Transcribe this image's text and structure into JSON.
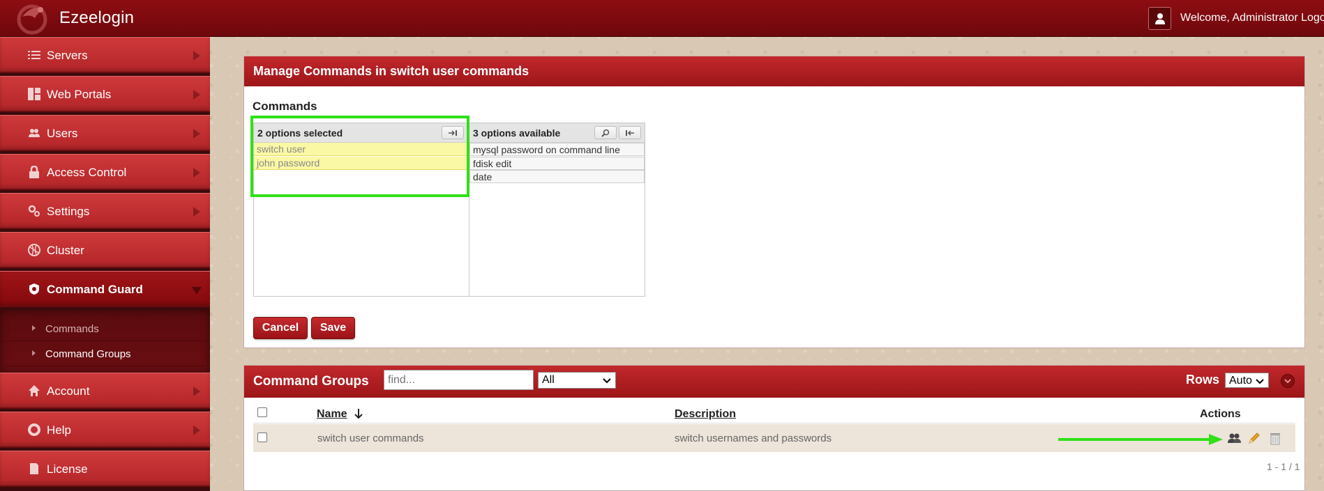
{
  "app": {
    "title": "Ezeelogin",
    "welcome": "Welcome, Administrator Logout"
  },
  "sidebar": {
    "items": [
      {
        "label": "Servers",
        "icon": "list-icon"
      },
      {
        "label": "Web Portals",
        "icon": "dashboard-icon"
      },
      {
        "label": "Users",
        "icon": "users-icon"
      },
      {
        "label": "Access Control",
        "icon": "lock-icon"
      },
      {
        "label": "Settings",
        "icon": "gears-icon"
      },
      {
        "label": "Cluster",
        "icon": "globe-icon"
      },
      {
        "label": "Command Guard",
        "icon": "shield-icon"
      },
      {
        "label": "Account",
        "icon": "home-icon"
      },
      {
        "label": "Help",
        "icon": "lifebuoy-icon"
      },
      {
        "label": "License",
        "icon": "document-icon"
      }
    ],
    "subitems": [
      {
        "label": "Commands"
      },
      {
        "label": "Command Groups"
      }
    ]
  },
  "manage_panel": {
    "title": "Manage Commands in switch user commands",
    "commands_label": "Commands",
    "selected": {
      "header": "2 options selected",
      "options": [
        "switch user",
        "john password"
      ]
    },
    "available": {
      "header": "3 options available",
      "options": [
        "mysql password on command line",
        "fdisk edit",
        "date"
      ]
    },
    "cancel_label": "Cancel",
    "save_label": "Save"
  },
  "groups_panel": {
    "title": "Command Groups",
    "search_placeholder": "find...",
    "filter_value": "All",
    "rows_label": "Rows",
    "rows_value": "Auto",
    "columns": {
      "name": "Name",
      "description": "Description",
      "actions": "Actions"
    },
    "rows": [
      {
        "name": "switch user commands",
        "description": "switch usernames and passwords"
      }
    ],
    "pager": "1 - 1 / 1"
  },
  "colors": {
    "brand_red": "#b32528",
    "highlight_green": "#31e018",
    "selected_option_bg": "#fbf8a5"
  }
}
